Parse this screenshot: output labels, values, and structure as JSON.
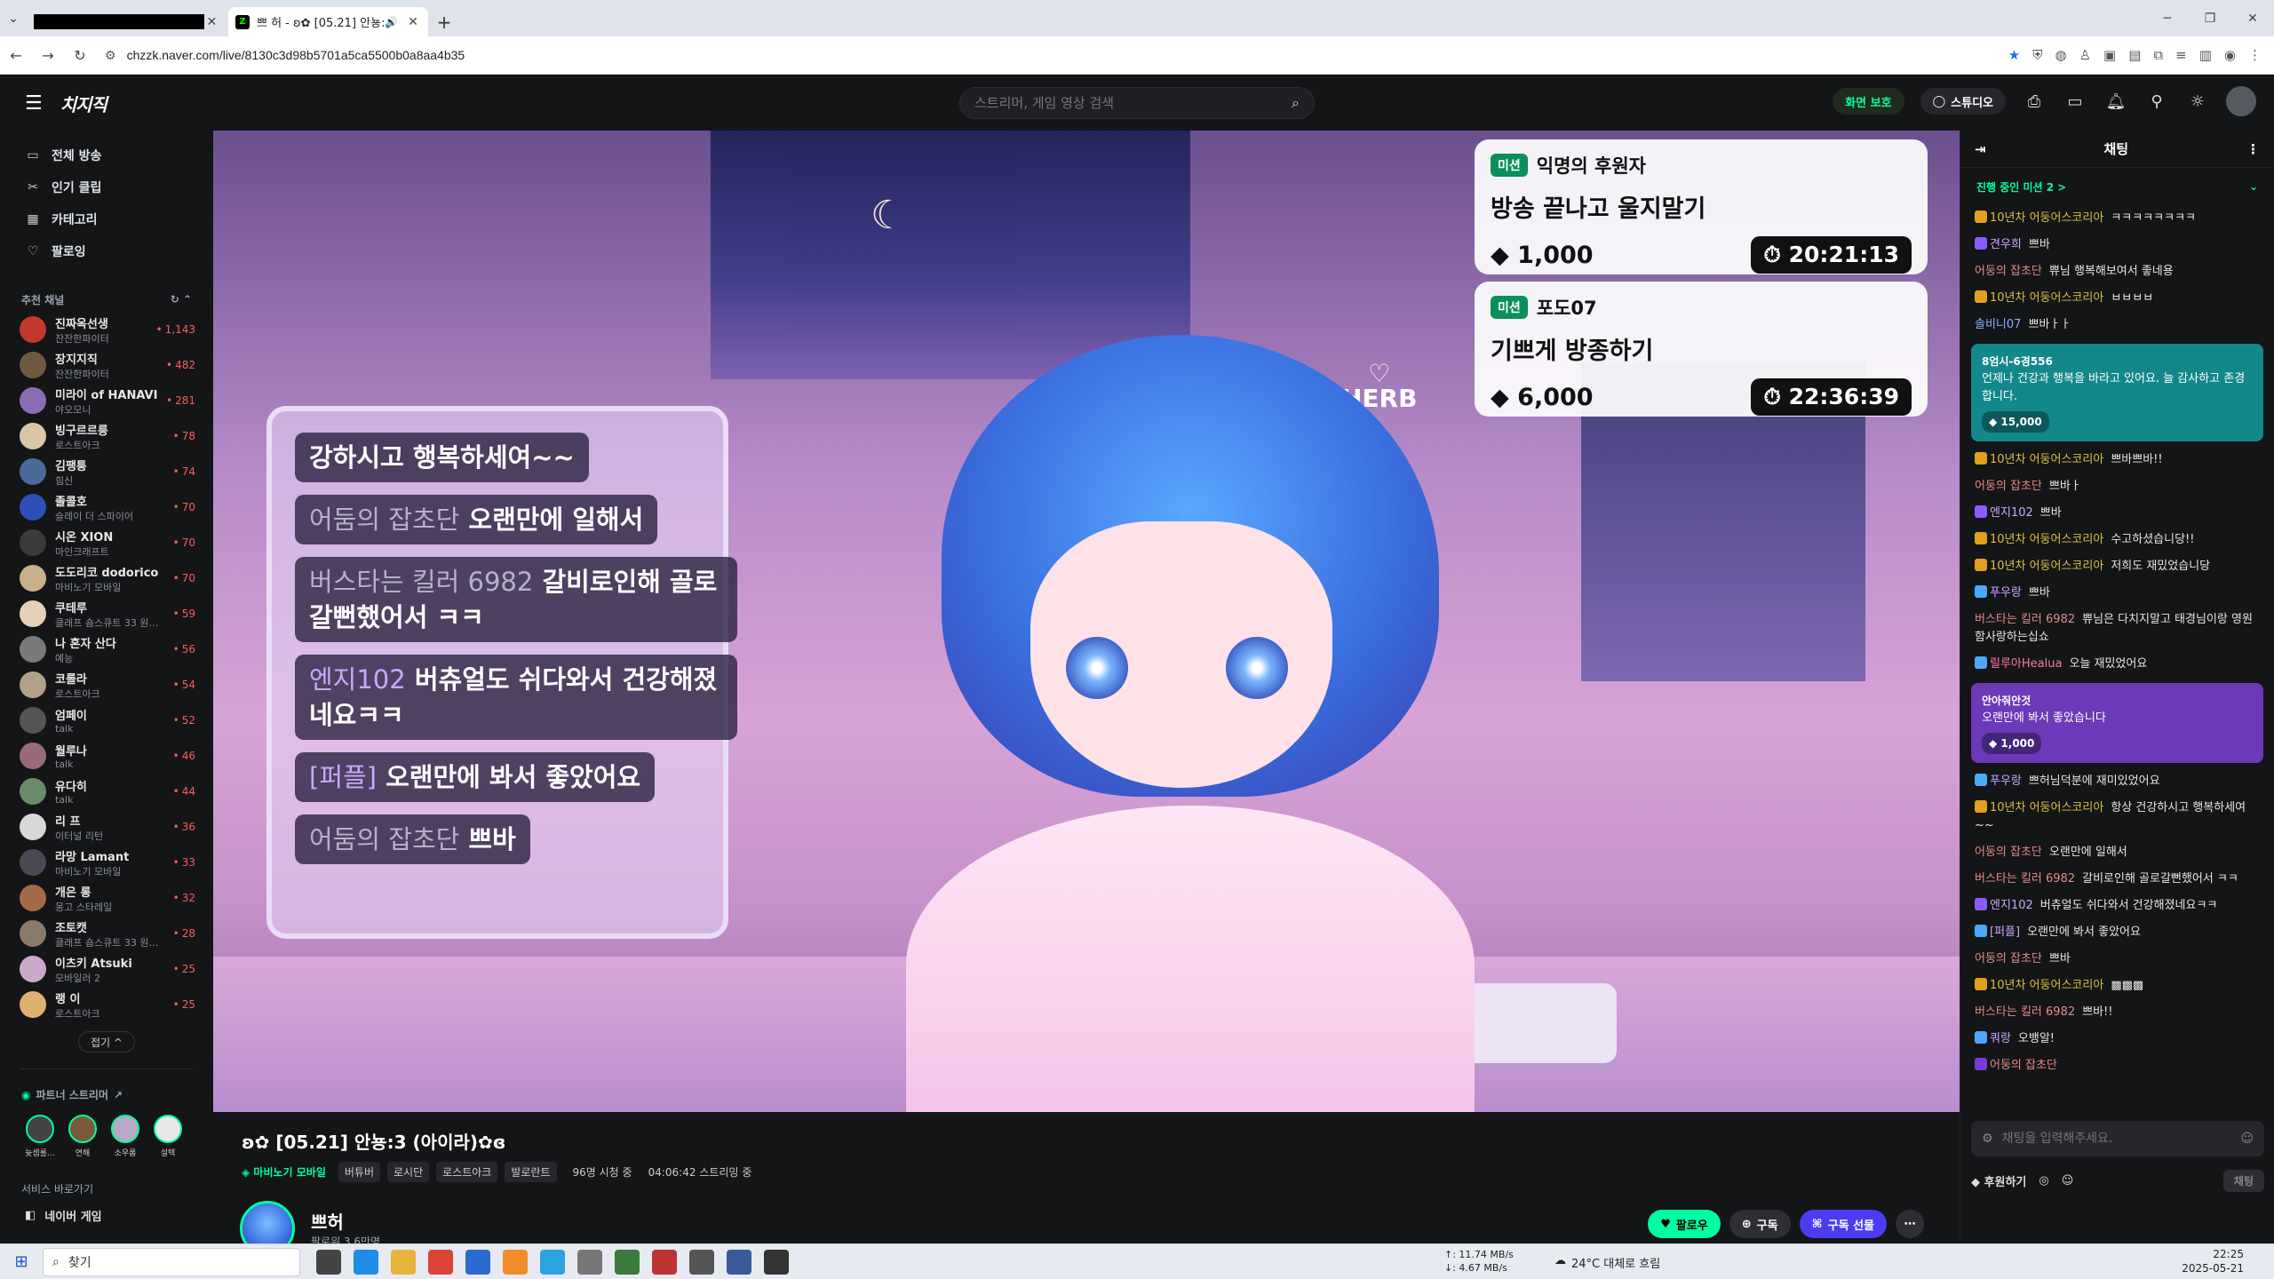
{
  "browser": {
    "tab1_close": "✕",
    "tab2_title": "쁘 허 - ʚ✿ [05.21] 안뇽:3",
    "tab2_speaker": "🔊",
    "tab2_close": "✕",
    "newtab": "+",
    "url": "chzzk.naver.com/live/8130c3d98b5701a5ca5500b0a8aa4b35"
  },
  "header": {
    "logo": "치지직",
    "search_placeholder": "스트리머, 게임 영상 검색",
    "protect_label": "화면 보호",
    "studio_label": "스튜디오"
  },
  "sidebar": {
    "menu": [
      {
        "label": "전체 방송",
        "icon": "broadcast-icon",
        "glyph": "▭"
      },
      {
        "label": "인기 클립",
        "icon": "clip-icon",
        "glyph": "✂"
      },
      {
        "label": "카테고리",
        "icon": "category-icon",
        "glyph": "▦"
      },
      {
        "label": "팔로잉",
        "icon": "heart-icon",
        "glyph": "♡"
      }
    ],
    "recommended_title": "추천 채널",
    "channels": [
      {
        "name": "진짜옥선생",
        "category": "잔잔한파이터",
        "viewers": "1,143",
        "color": "#c0392b"
      },
      {
        "name": "장지지직",
        "category": "잔잔한파이터",
        "viewers": "482",
        "color": "#6d5a3f"
      },
      {
        "name": "미라이 of HANAVI",
        "category": "야오모니",
        "viewers": "281",
        "color": "#8e6bb5"
      },
      {
        "name": "빙구르르릉",
        "category": "로스트아크",
        "viewers": "78",
        "color": "#d9c6a8"
      },
      {
        "name": "김팽틍",
        "category": "힘신",
        "viewers": "74",
        "color": "#4a6a9a"
      },
      {
        "name": "졸콜호",
        "category": "슬레이 더 스파이어",
        "viewers": "70",
        "color": "#2e4fb5"
      },
      {
        "name": "시온 XION",
        "category": "마인크래프트",
        "viewers": "70",
        "color": "#3a3a3a"
      },
      {
        "name": "도도리코 dodorico",
        "category": "마비노기 모바일",
        "viewers": "70",
        "color": "#c9b08a"
      },
      {
        "name": "쿠테루",
        "category": "클래프 숍스큐트 33 원…",
        "viewers": "59",
        "color": "#e6d0b8"
      },
      {
        "name": "나 혼자 산다",
        "category": "예능",
        "viewers": "56",
        "color": "#7a7a7a"
      },
      {
        "name": "코롤라",
        "category": "로스트아크",
        "viewers": "54",
        "color": "#b3a089"
      },
      {
        "name": "엄페이",
        "category": "talk",
        "viewers": "52",
        "color": "#555555"
      },
      {
        "name": "월루나",
        "category": "talk",
        "viewers": "46",
        "color": "#9a6a7a"
      },
      {
        "name": "유다히",
        "category": "talk",
        "viewers": "44",
        "color": "#6a8a6a"
      },
      {
        "name": "리 프",
        "category": "이터널 리턴",
        "viewers": "36",
        "color": "#d8d8d8"
      },
      {
        "name": "라망 Lamant",
        "category": "마비노기 모바일",
        "viewers": "33",
        "color": "#4a4a55"
      },
      {
        "name": "개은 롱",
        "category": "몽고 스타레일",
        "viewers": "32",
        "color": "#a56a4a"
      },
      {
        "name": "조토캣",
        "category": "클래프 숍스큐트 33 원…",
        "viewers": "28",
        "color": "#8a7a6a"
      },
      {
        "name": "이츠키 Atsuki",
        "category": "모바일러 2",
        "viewers": "25",
        "color": "#c9a8c9"
      },
      {
        "name": "랭 이",
        "category": "로스트아크",
        "viewers": "25",
        "color": "#e0b070"
      }
    ],
    "more_label": "접기 ^",
    "partner_title": "파트너 스트리머",
    "partners": [
      {
        "name": "늦셉롤…",
        "color": "#444"
      },
      {
        "name": "연해",
        "color": "#7a5a3a"
      },
      {
        "name": "소우롬",
        "color": "#b9a8c9"
      },
      {
        "name": "설텍",
        "color": "#e8e8e8"
      }
    ],
    "service_title": "서비스 바로가기",
    "service_item": "네이버 게임"
  },
  "video": {
    "herb_logo": "HERB",
    "overlay_chat": [
      {
        "nick": "",
        "text": "강하시고 행복하세여~~"
      },
      {
        "nick": "어둠의 잡초단",
        "text": "오랜만에 일해서"
      },
      {
        "nick": "버스타는 킬러 6982",
        "text": "갈비로인해 골로갈뻔했어서 ㅋㅋ"
      },
      {
        "nick": "엔지102",
        "text": "버츄얼도 쉬다와서 건강해졌네요ㅋㅋ"
      },
      {
        "nick": "[퍼플]",
        "text": "오랜만에 봐서 좋았어요"
      },
      {
        "nick": "어둠의 잡초단",
        "text": "쁘바"
      }
    ],
    "missions": [
      {
        "tag": "미션",
        "user": "익명의 후원자",
        "title": "방송 끝나고 울지말기",
        "amount": "1,000",
        "timer": "20:21:13"
      },
      {
        "tag": "미션",
        "user": "포도07",
        "title": "기쁘게 방종하기",
        "amount": "6,000",
        "timer": "22:36:39"
      }
    ]
  },
  "stream": {
    "title": "ʚ✿ [05.21] 안뇽:3 (아이라)✿ɞ",
    "game": "마비노기 모바일",
    "tags": [
      "버튜버",
      "로시단",
      "로스트아크",
      "발로란트"
    ],
    "viewers": "96명 시청 중",
    "uptime": "04:06:42 스트리밍 중",
    "streamer_name": "쁘허",
    "followers": "팔로워 3.6만명",
    "follow_label": "팔로우",
    "subscribe_label": "구독",
    "gift_label": "구독 선물",
    "more": "⋯"
  },
  "chat": {
    "title": "채팅",
    "mission_bar": "진행 중인 미션 2 >",
    "messages": [
      {
        "nick": "10년차 어둥어스코리아",
        "text": "ㅋㅋㅋㅋㅋㅋㅋㅋ",
        "color": "#d8c040",
        "badge": "#e0a020"
      },
      {
        "nick": "견우희",
        "text": "쁘바",
        "color": "#c9a8ff",
        "badge": "#8a5cff"
      },
      {
        "nick": "어둥의 잡초단",
        "text": "쀼님 행복해보여서 좋네용",
        "color": "#e58a8a",
        "badge": ""
      },
      {
        "nick": "10년차 어둥어스코리아",
        "text": "ㅂㅂㅂㅂ",
        "color": "#d8c040",
        "badge": "#e0a020"
      },
      {
        "nick": "솔비니07",
        "text": "쁘바ㅏㅏ",
        "color": "#8ab0ff",
        "badge": ""
      }
    ],
    "donation1": {
      "nick": "8엄시-6경556",
      "text": "언제나 건강과 행복을 바라고 있어요. 늘 감사하고 존경합니다.",
      "amount": "15,000",
      "color": "#13888a"
    },
    "messages2": [
      {
        "nick": "10년차 어둥어스코리아",
        "text": "쁘바쁘바!!",
        "color": "#d8c040",
        "badge": "#e0a020"
      },
      {
        "nick": "어둥의 잡초단",
        "text": "쁘바ㅏ",
        "color": "#e58a8a",
        "badge": ""
      },
      {
        "nick": "엔지102",
        "text": "쁘바",
        "color": "#c9a8ff",
        "badge": "#8a5cff"
      },
      {
        "nick": "10년차 어둥어스코리아",
        "text": "수고하셨습니당!!",
        "color": "#d8c040",
        "badge": "#e0a020"
      },
      {
        "nick": "10년차 어둥어스코리아",
        "text": "저희도 재밌었습니당",
        "color": "#d8c040",
        "badge": "#e0a020"
      },
      {
        "nick": "푸우랑",
        "text": "쁘바",
        "color": "#c9a8ff",
        "badge": "#4aa8ff"
      },
      {
        "nick": "버스타는 킬러 6982",
        "text": "쀼님은 다치지말고 태경님이랑 영원함사랑하는십쇼",
        "color": "#e58a8a",
        "badge": ""
      },
      {
        "nick": "릴루아Healua",
        "text": "오늘 재밌었어요",
        "color": "#ff7aa8",
        "badge": "#4aa8ff"
      }
    ],
    "donation2": {
      "nick": "안아줘안것",
      "text": "오랜만에 봐서 좋았습니다",
      "amount": "1,000",
      "color": "#6a3ab8"
    },
    "messages3": [
      {
        "nick": "푸우랑",
        "text": "쁘허님덕분에 재미있었어요",
        "color": "#c9a8ff",
        "badge": "#4aa8ff"
      },
      {
        "nick": "10년차 어둥어스코리아",
        "text": "항상 건강하시고 행복하세여~~",
        "color": "#d8c040",
        "badge": "#e0a020"
      },
      {
        "nick": "어둥의 잡초단",
        "text": "오랜만에 일해서",
        "color": "#e58a8a",
        "badge": ""
      },
      {
        "nick": "버스타는 킬러 6982",
        "text": "갈비로인해 골로갈뻔했어서 ㅋㅋ",
        "color": "#e58a8a",
        "badge": ""
      },
      {
        "nick": "엔지102",
        "text": "버츄얼도 쉬다와서 건강해졌네요ㅋㅋ",
        "color": "#c9a8ff",
        "badge": "#8a5cff"
      },
      {
        "nick": "[퍼플]",
        "text": "오랜만에 봐서 좋았어요",
        "color": "#c9a8ff",
        "badge": "#4aa8ff"
      },
      {
        "nick": "어둥의 잡초단",
        "text": "쁘바",
        "color": "#e58a8a",
        "badge": ""
      },
      {
        "nick": "10년차 어둥어스코리아",
        "text": "▩▩▩",
        "color": "#d8c040",
        "badge": "#e0a020"
      },
      {
        "nick": "버스타는 킬러 6982",
        "text": "쁘바!!",
        "color": "#e58a8a",
        "badge": ""
      },
      {
        "nick": "쿼랑",
        "text": "오뱅알!",
        "color": "#c9a8ff",
        "badge": "#4aa8ff"
      },
      {
        "nick": "어둥의 잡초단",
        "text": "",
        "color": "#e58a8a",
        "badge": "#7a3ad8"
      }
    ],
    "input_placeholder": "채팅을 입력해주세요.",
    "donate_label": "후원하기",
    "send_label": "채팅"
  },
  "taskbar": {
    "search_label": "찾기",
    "net_up": "↑: 11.74 MB/s",
    "net_down": "↓: 4.67 MB/s",
    "weather": "24°C 대체로 흐림",
    "time": "22:25",
    "date": "2025-05-21"
  }
}
